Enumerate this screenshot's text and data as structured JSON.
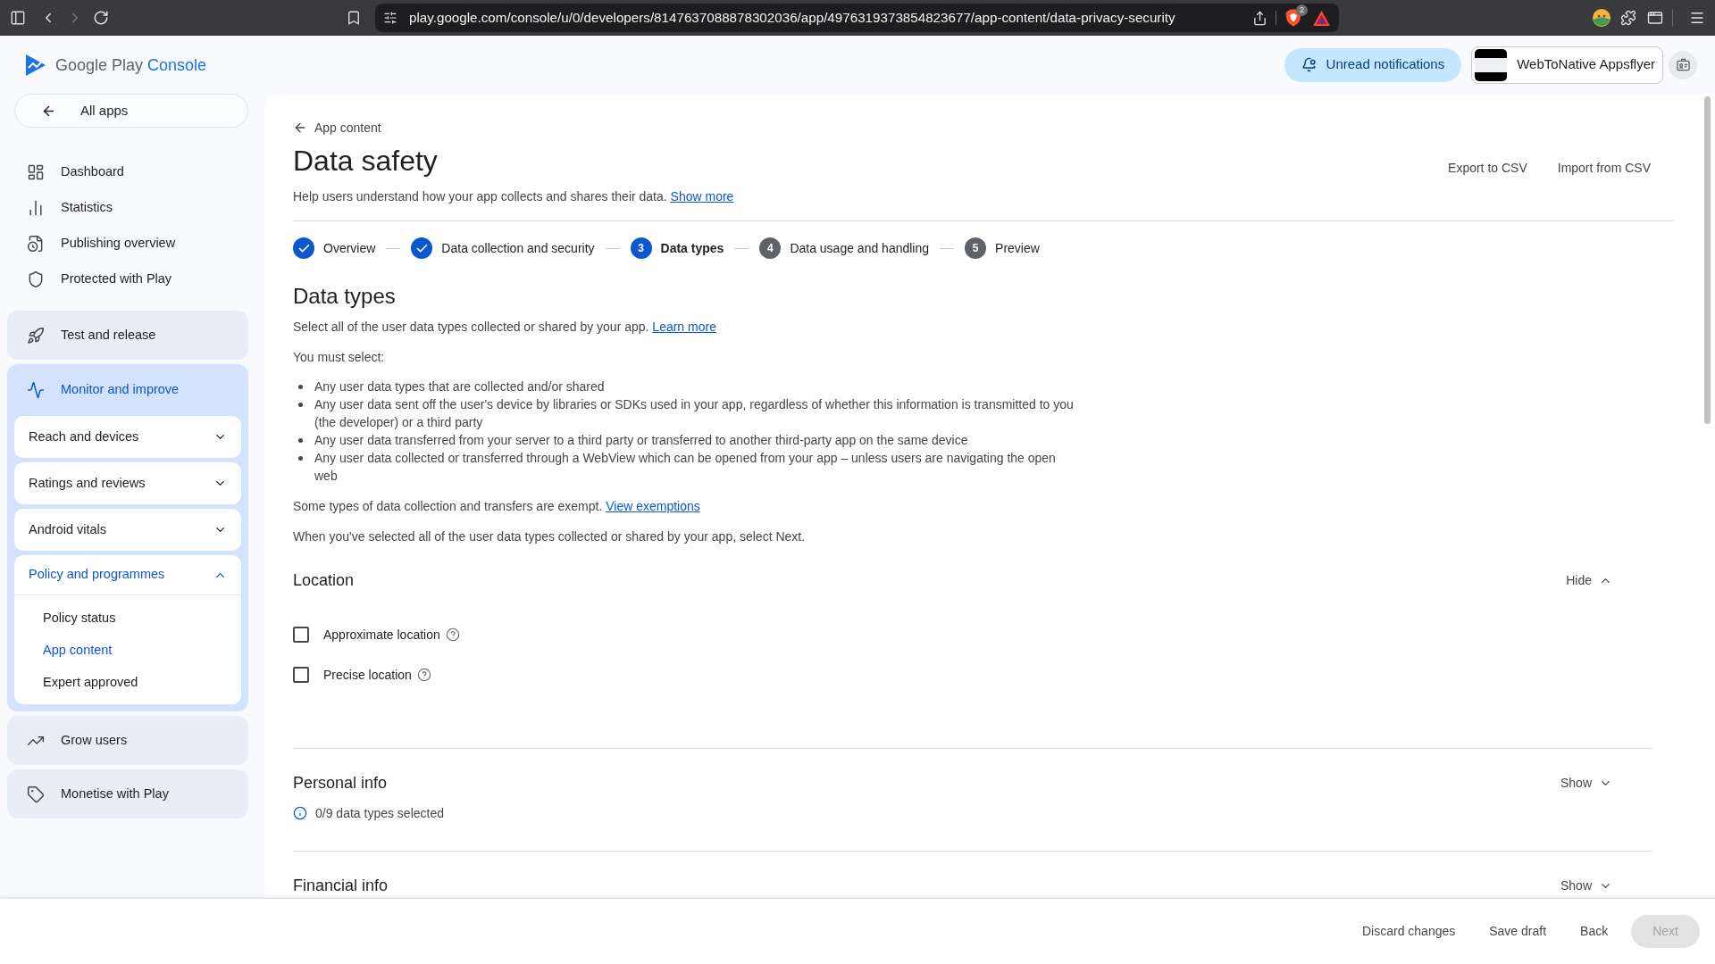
{
  "browser": {
    "forward_disabled": true,
    "url": "play.google.com/console/u/0/developers/8147637088878302036/app/4976319373854823677/app-content/data-privacy-security",
    "shields_count": "2"
  },
  "header": {
    "logo": {
      "brand": "Google Play",
      "product": "Console"
    },
    "notifications_button": "Unread notifications",
    "account": {
      "name": "WebToNative Appsflyer"
    }
  },
  "sidebar": {
    "back_link": "All apps",
    "items": [
      {
        "label": "Dashboard"
      },
      {
        "label": "Statistics"
      },
      {
        "label": "Publishing overview"
      },
      {
        "label": "Protected with Play"
      }
    ],
    "sections": [
      {
        "label": "Test and release",
        "selected": false
      },
      {
        "label": "Monitor and improve",
        "selected": true,
        "children": [
          {
            "label": "Reach and devices",
            "expanded": false
          },
          {
            "label": "Ratings and reviews",
            "expanded": false
          },
          {
            "label": "Android vitals",
            "expanded": false
          },
          {
            "label": "Policy and programmes",
            "expanded": true,
            "children": [
              {
                "label": "Policy status",
                "selected": false
              },
              {
                "label": "App content",
                "selected": true
              },
              {
                "label": "Expert approved",
                "selected": false
              }
            ]
          }
        ]
      },
      {
        "label": "Grow users",
        "selected": false
      },
      {
        "label": "Monetise with Play",
        "selected": false
      }
    ]
  },
  "page": {
    "back_link": "App content",
    "title": "Data safety",
    "actions": [
      "Export to CSV",
      "Import from CSV"
    ],
    "description": "Help users understand how your app collects and shares their data.",
    "description_link": "Show more",
    "steps": [
      {
        "label": "Overview",
        "completed": true,
        "selected": false
      },
      {
        "label": "Data collection and security",
        "completed": true,
        "selected": false
      },
      {
        "number": "3",
        "label": "Data types",
        "completed": false,
        "selected": true
      },
      {
        "number": "4",
        "label": "Data usage and handling",
        "completed": false,
        "selected": false
      },
      {
        "number": "5",
        "label": "Preview",
        "completed": false,
        "selected": false
      }
    ]
  },
  "data_types": {
    "title": "Data types",
    "intro": "Select all of the user data types collected or shared by your app.",
    "intro_link": "Learn more",
    "must_select": "You must select:",
    "requirements": [
      "Any user data types that are collected and/or shared",
      "Any user data sent off the user's device by libraries or SDKs used in your app, regardless of whether this information is transmitted to you (the developer) or a third party",
      "Any user data transferred from your server to a third party or transferred to another third-party app on the same device",
      "Any user data collected or transferred through a WebView which can be opened from your app – unless users are navigating the open web"
    ],
    "exempt_note": "Some types of data collection and transfers are exempt.",
    "exempt_link": "View exemptions",
    "next_note": "When you've selected all of the user data types collected or shared by your app, select Next."
  },
  "categories": [
    {
      "title": "Location",
      "expanded": true,
      "toggle": "Hide",
      "options": [
        {
          "label": "Approximate location",
          "checked": false
        },
        {
          "label": "Precise location",
          "checked": false
        }
      ]
    },
    {
      "title": "Personal info",
      "expanded": false,
      "toggle": "Show",
      "summary": "0/9 data types selected"
    },
    {
      "title": "Financial info",
      "expanded": false,
      "toggle": "Show"
    }
  ],
  "footer": {
    "buttons": [
      {
        "label": "Discard changes",
        "kind": "text",
        "disabled": false
      },
      {
        "label": "Save draft",
        "kind": "text",
        "disabled": false
      },
      {
        "label": "Back",
        "kind": "text",
        "disabled": false
      },
      {
        "label": "Next",
        "kind": "primary",
        "disabled": true
      }
    ]
  }
}
